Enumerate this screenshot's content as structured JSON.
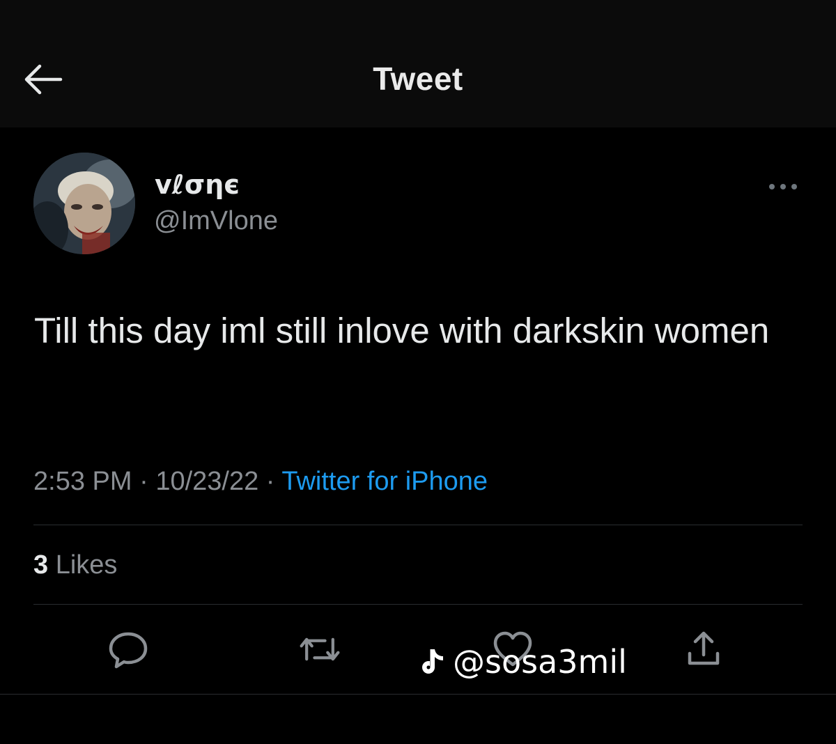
{
  "header": {
    "title": "Tweet",
    "back_icon": "arrow-left-icon"
  },
  "tweet": {
    "author": {
      "display_name": "vℓσηє",
      "handle": "@ImVlone"
    },
    "more_icon": "more-horizontal-icon",
    "text": "Till this day iml still inlove with darkskin women",
    "time": "2:53 PM",
    "date": "10/23/22",
    "separator": "·",
    "source": "Twitter for iPhone",
    "likes": {
      "count": "3",
      "label": "Likes"
    },
    "actions": [
      {
        "name": "reply",
        "icon": "reply-icon"
      },
      {
        "name": "retweet",
        "icon": "retweet-icon"
      },
      {
        "name": "like",
        "icon": "heart-icon"
      },
      {
        "name": "share",
        "icon": "share-icon"
      }
    ]
  },
  "watermark": {
    "icon": "tiktok-icon",
    "text": "@sosa3mil"
  },
  "colors": {
    "background": "#000000",
    "header_background": "#0b0b0b",
    "text_primary": "#e7e9ea",
    "text_secondary": "#8b8f94",
    "link": "#1d9bf0",
    "divider": "#2a2d30"
  }
}
